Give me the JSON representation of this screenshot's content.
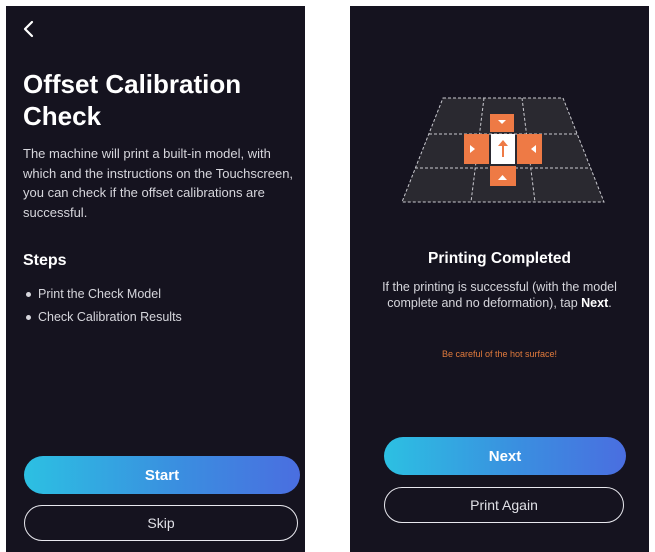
{
  "left_screen": {
    "title": "Offset Calibration Check",
    "description": "The machine will print a built-in model, with which and the instructions on the Touchscreen, you can check if the offset calibrations are successful.",
    "steps_heading": "Steps",
    "steps": [
      "Print the Check Model",
      "Check Calibration Results"
    ],
    "start_label": "Start",
    "skip_label": "Skip"
  },
  "right_screen": {
    "status_title": "Printing Completed",
    "message_prefix": "If the printing is successful (with the model complete and no deformation), tap ",
    "message_emphasis": "Next",
    "message_suffix": ".",
    "warning": "Be careful of the hot surface!",
    "next_label": "Next",
    "print_again_label": "Print Again"
  },
  "icons": {
    "back": "chevron-left-icon",
    "graphic": "calibration-model-graphic"
  },
  "colors": {
    "background": "#15131f",
    "accent_orange": "#ee7a45",
    "warning_text": "#e07a3c",
    "button_gradient_start": "#2cc0e2",
    "button_gradient_end": "#4a6ee0"
  }
}
